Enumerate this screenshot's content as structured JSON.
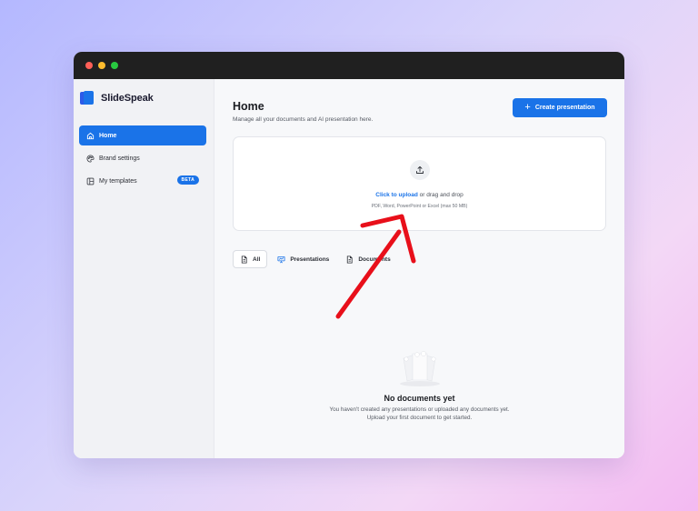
{
  "brand": {
    "name": "SlideSpeak"
  },
  "sidebar": {
    "items": [
      {
        "label": "Home",
        "icon": "home-icon",
        "active": true
      },
      {
        "label": "Brand settings",
        "icon": "palette-icon"
      },
      {
        "label": "My templates",
        "icon": "layout-icon",
        "badge": "BETA"
      }
    ]
  },
  "header": {
    "title": "Home",
    "subtitle": "Manage all your documents and AI presentation here.",
    "create_label": "Create presentation"
  },
  "upload": {
    "link_text": "Click to upload",
    "rest_text": " or drag and drop",
    "hint": "PDF, Word, PowerPoint or Excel (max 50 MB)"
  },
  "filters": [
    {
      "label": "All",
      "icon": "document-icon"
    },
    {
      "label": "Presentations",
      "icon": "presentation-icon"
    },
    {
      "label": "Documents",
      "icon": "document-icon"
    }
  ],
  "empty_state": {
    "title": "No documents yet",
    "text": "You haven't created any presentations or uploaded any documents yet. Upload your first document to get started."
  },
  "colors": {
    "accent": "#1a73e8",
    "annotation_arrow": "#e80f1a"
  }
}
